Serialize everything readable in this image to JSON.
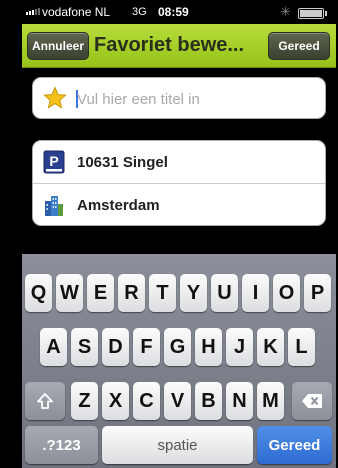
{
  "status": {
    "carrier": "vodafone NL",
    "network": "3G",
    "time": "08:59"
  },
  "nav": {
    "cancel_label": "Annuleer",
    "title": "Favoriet bewe...",
    "done_label": "Gereed"
  },
  "title_field": {
    "placeholder": "Vul hier een titel in",
    "value": ""
  },
  "details": {
    "street": "10631 Singel",
    "city": "Amsterdam"
  },
  "keyboard": {
    "row1": [
      "Q",
      "W",
      "E",
      "R",
      "T",
      "Y",
      "U",
      "I",
      "O",
      "P"
    ],
    "row2": [
      "A",
      "S",
      "D",
      "F",
      "G",
      "H",
      "J",
      "K",
      "L"
    ],
    "row3": [
      "Z",
      "X",
      "C",
      "V",
      "B",
      "N",
      "M"
    ],
    "numbers_label": ".?123",
    "space_label": "spatie",
    "return_label": "Gereed"
  },
  "colors": {
    "navbar": "#a9d02c",
    "return_key": "#3a7bdc"
  }
}
